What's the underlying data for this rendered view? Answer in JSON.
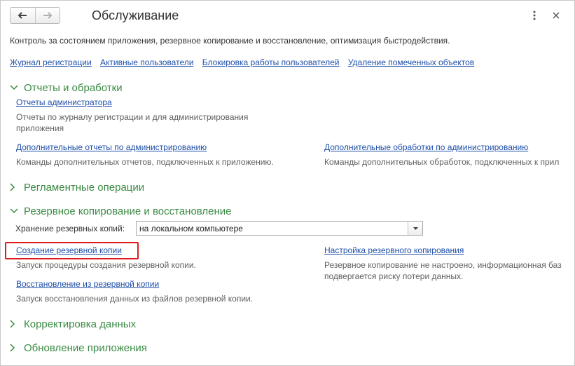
{
  "window": {
    "title": "Обслуживание",
    "description": "Контроль за состоянием приложения, резервное копирование и восстановление, оптимизация быстродействия."
  },
  "top_links": [
    "Журнал регистрации",
    "Активные пользователи",
    "Блокировка работы пользователей",
    "Удаление помеченных объектов"
  ],
  "sections": {
    "reports": {
      "title": "Отчеты и обработки",
      "expanded": true,
      "admin_reports": {
        "link": "Отчеты администратора",
        "text": "Отчеты по журналу регистрации и для администрирования приложения"
      },
      "extra_reports": {
        "link": "Дополнительные отчеты по администрированию",
        "text": "Команды дополнительных отчетов, подключенных к приложению."
      },
      "extra_processors": {
        "link": "Дополнительные обработки по администрированию",
        "text": "Команды дополнительных обработок, подключенных к прил"
      }
    },
    "scheduled": {
      "title": "Регламентные операции",
      "expanded": false
    },
    "backup": {
      "title": "Резервное копирование и восстановление",
      "expanded": true,
      "storage_label": "Хранение резервных копий:",
      "storage_value": "на локальном компьютере",
      "create": {
        "link": "Создание резервной копии",
        "text": "Запуск процедуры создания резервной копии."
      },
      "settings": {
        "link": "Настройка резервного копирования",
        "text": "Резервное копирование не настроено, информационная баз подвергается риску потери данных."
      },
      "restore": {
        "link": "Восстановление из резервной копии",
        "text": "Запуск восстановления данных из файлов резервной копии."
      }
    },
    "correction": {
      "title": "Корректировка данных",
      "expanded": false
    },
    "update": {
      "title": "Обновление приложения",
      "expanded": false
    }
  },
  "colors": {
    "link": "#1f4fa8",
    "section": "#3a8a42",
    "highlight": "#e0191c"
  },
  "icons": [
    "arrow-left-icon",
    "arrow-right-icon",
    "more-icon",
    "close-icon",
    "chevron-down-icon",
    "chevron-right-icon"
  ]
}
